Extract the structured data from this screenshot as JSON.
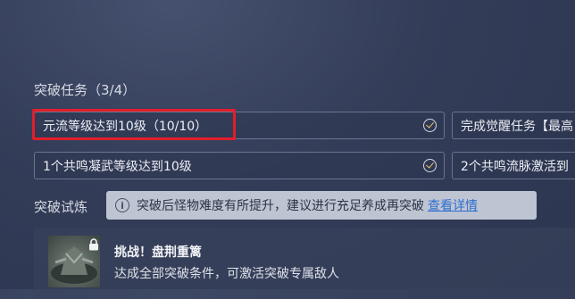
{
  "breakthrough_tasks": {
    "title": "突破任务（3/4）",
    "tasks": [
      {
        "label": "元流等级达到10级（10/10）"
      },
      {
        "label": "完成觉醒任务【最高"
      },
      {
        "label": "1个共鸣凝武等级达到10级"
      },
      {
        "label": "2个共鸣流脉激活到"
      }
    ]
  },
  "breakthrough_trial": {
    "title": "突破试炼",
    "tooltip": {
      "icon": "info-icon",
      "text": "突破后怪物难度有所提升，建议进行充足养成再突破",
      "link": "查看详情"
    },
    "challenge": {
      "title": "挑战！盘荆重篱",
      "description": "达成全部突破条件，可激活突破专属敌人",
      "lock_icon": "lock-icon"
    }
  },
  "colors": {
    "highlight": "#e31d2b",
    "check": "#e8c96a",
    "link": "#2f6fd0"
  }
}
